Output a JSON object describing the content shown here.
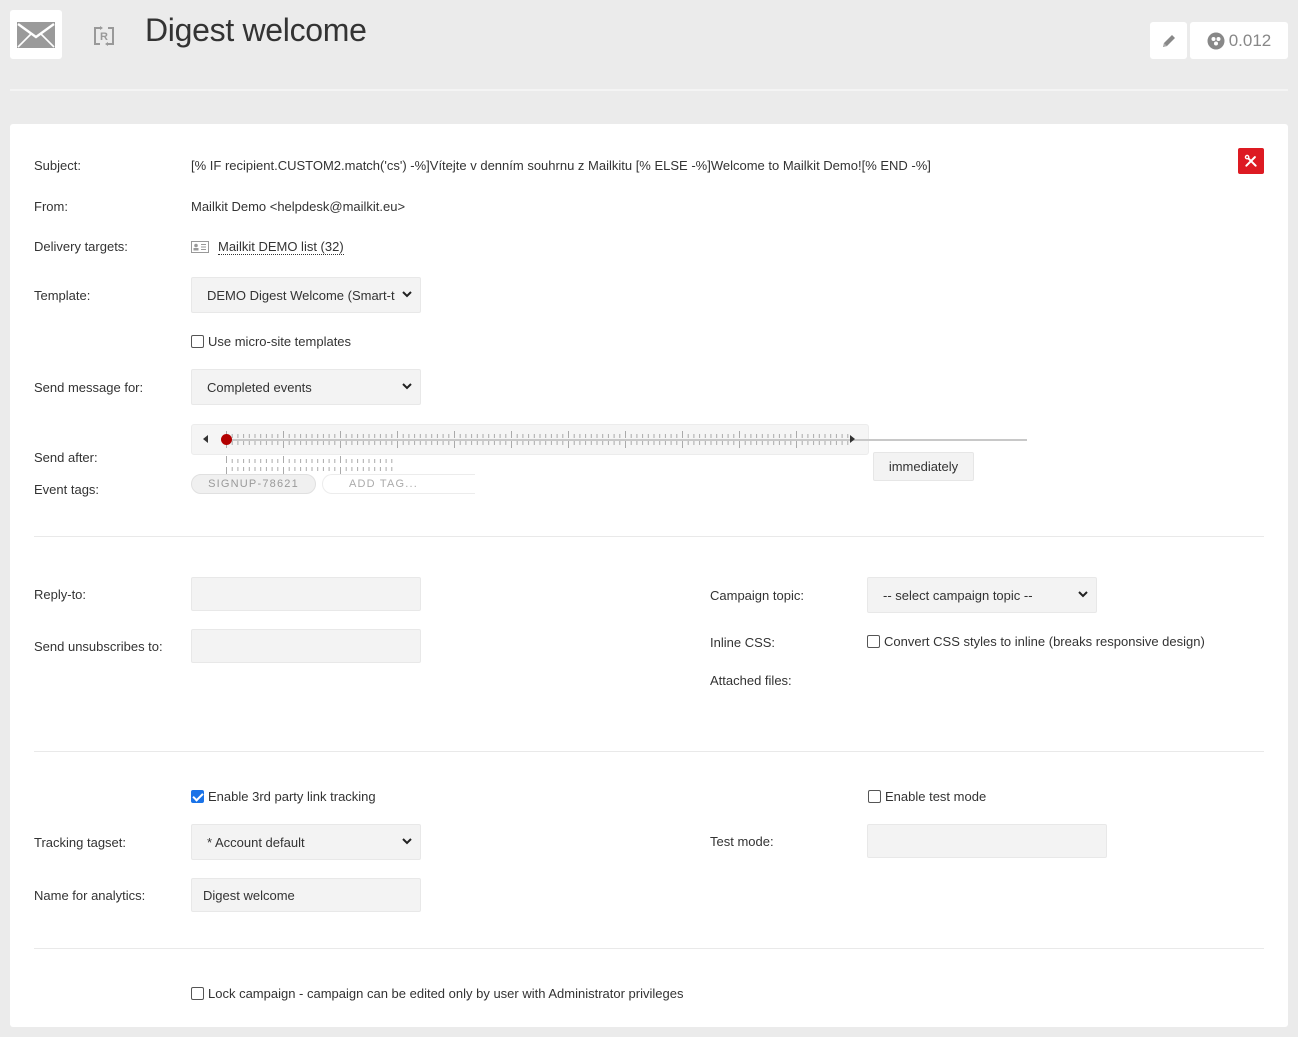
{
  "header": {
    "title": "Digest welcome",
    "logo_icon": "envelope-icon",
    "type_icon": "recurring-campaign-icon",
    "edit_icon": "pencil-icon",
    "score_icon": "radiation-score-icon",
    "score_value": "0.012"
  },
  "form": {
    "tools_icon": "wrench-screwdriver-icon",
    "subject": {
      "label": "Subject:",
      "value": "[% IF recipient.CUSTOM2.match('cs') -%]Vítejte v denním souhrnu z Mailkitu [% ELSE -%]Welcome to Mailkit Demo![% END -%]"
    },
    "from": {
      "label": "From:",
      "value": "Mailkit Demo <helpdesk@mailkit.eu>"
    },
    "delivery_targets": {
      "label": "Delivery targets:",
      "icon": "contact-card-icon",
      "value": "Mailkit DEMO list (32)"
    },
    "template": {
      "label": "Template:",
      "selected": "DEMO Digest Welcome (Smart-t"
    },
    "micro_site": {
      "label": "Use micro-site templates",
      "checked": false
    },
    "send_message_for": {
      "label": "Send message for:",
      "selected": "Completed events"
    },
    "send_after": {
      "label": "Send after:",
      "value_label": "immediately",
      "slider_position": 0
    },
    "event_tags": {
      "label": "Event tags:",
      "tags": [
        "SIGNUP-78621"
      ],
      "placeholder": "ADD TAG..."
    }
  },
  "options": {
    "reply_to": {
      "label": "Reply-to:",
      "value": ""
    },
    "unsubscribes_to": {
      "label": "Send unsubscribes to:",
      "value": ""
    },
    "campaign_topic": {
      "label": "Campaign topic:",
      "selected": "-- select campaign topic --"
    },
    "inline_css": {
      "label": "Inline CSS:",
      "checkbox_label": "Convert CSS styles to inline (breaks responsive design)",
      "checked": false
    },
    "attached_files": {
      "label": "Attached files:"
    }
  },
  "tracking": {
    "third_party": {
      "label": "Enable 3rd party link tracking",
      "checked": true
    },
    "tagset": {
      "label": "Tracking tagset:",
      "selected": "* Account default"
    },
    "analytics_name": {
      "label": "Name for analytics:",
      "value": "Digest welcome"
    },
    "test_mode_enable": {
      "label": "Enable test mode",
      "checked": false
    },
    "test_mode": {
      "label": "Test mode:",
      "value": ""
    }
  },
  "lock": {
    "label": "Lock campaign - campaign can be edited only by user with Administrator privileges",
    "checked": false
  }
}
